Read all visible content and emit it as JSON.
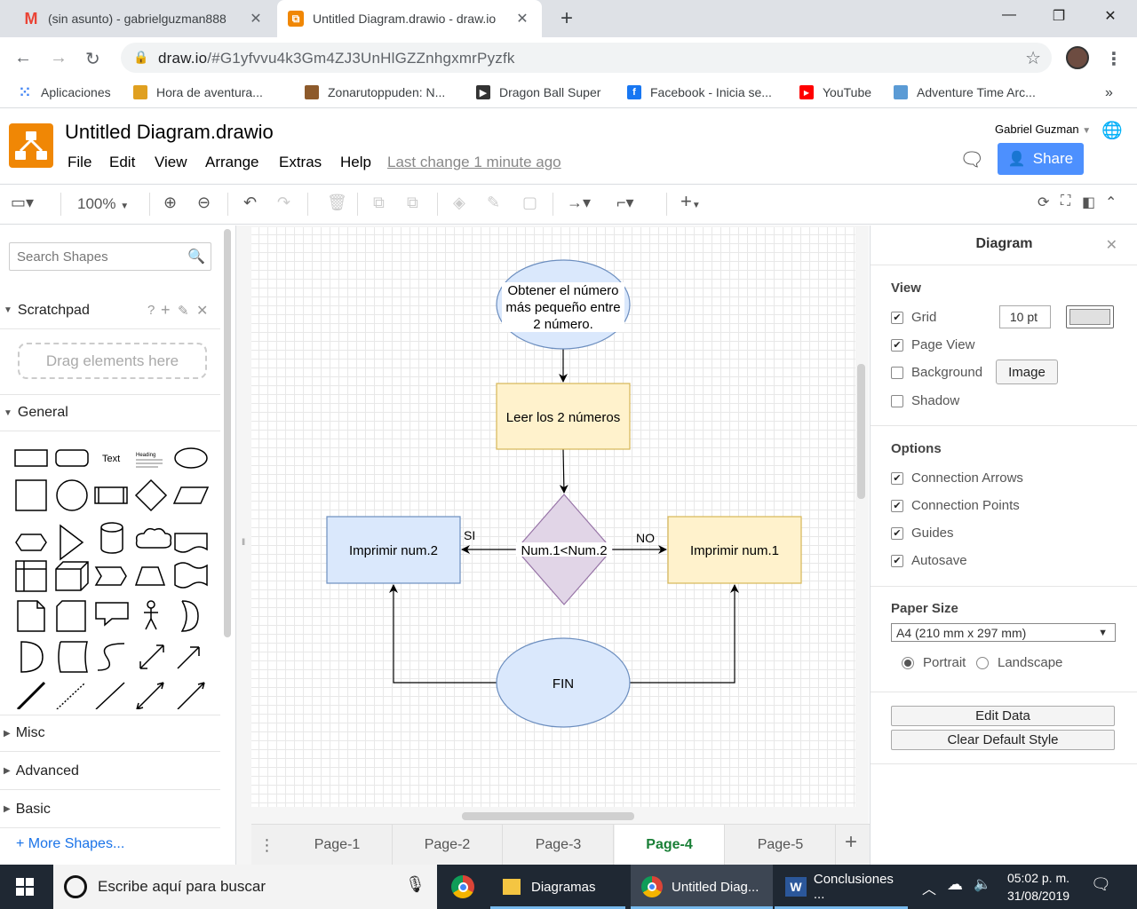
{
  "browser": {
    "tabs": [
      {
        "title": "(sin asunto) - gabrielguzman888",
        "icon": "gmail-icon"
      },
      {
        "title": "Untitled Diagram.drawio - draw.io",
        "icon": "drawio-icon"
      }
    ],
    "url_host": "draw.io",
    "url_path": "/#G1yfvvu4k3Gm4ZJ3UnHlGZZnhgxmrPyzfk",
    "bookmarks": [
      {
        "label": "Aplicaciones",
        "color": "#4285f4"
      },
      {
        "label": "Hora de aventura...",
        "color": "#e0a020"
      },
      {
        "label": "Zonarutoppuden: N...",
        "color": "#8d5a2b"
      },
      {
        "label": "Dragon Ball Super",
        "color": "#333333"
      },
      {
        "label": "Facebook - Inicia se...",
        "color": "#1877f2"
      },
      {
        "label": "YouTube",
        "color": "#ff0000"
      },
      {
        "label": "Adventure Time Arc...",
        "color": "#5b9bd5"
      }
    ]
  },
  "app": {
    "title": "Untitled Diagram.drawio",
    "menus": [
      "File",
      "Edit",
      "View",
      "Arrange",
      "Extras",
      "Help"
    ],
    "last_change": "Last change 1 minute ago",
    "user": "Gabriel Guzman",
    "share_label": "Share",
    "zoom": "100%"
  },
  "left": {
    "search_placeholder": "Search Shapes",
    "scratchpad": "Scratchpad",
    "scratchpad_tools": "?",
    "drag_hint": "Drag elements here",
    "general": "General",
    "shape_text": "Text",
    "shape_heading": "Heading",
    "misc": "Misc",
    "advanced": "Advanced",
    "basic": "Basic",
    "more_shapes": "+ More Shapes..."
  },
  "diagram": {
    "start_lines": [
      "Obtener el número",
      "más pequeño entre",
      "2 número."
    ],
    "read": "Leer los 2 números",
    "decision": "Num.1<Num.2",
    "yes": "SI",
    "no": "NO",
    "out_left": "Imprimir num.2",
    "out_right": "Imprimir num.1",
    "end": "FIN",
    "colors": {
      "blue_fill": "#dae8fc",
      "blue_stroke": "#6c8ebf",
      "yellow_fill": "#fff2cc",
      "yellow_stroke": "#d6b656",
      "purple_fill": "#e1d5e7",
      "purple_stroke": "#9673a6"
    }
  },
  "right": {
    "title": "Diagram",
    "view": "View",
    "grid": "Grid",
    "grid_size": "10 pt",
    "page_view": "Page View",
    "background": "Background",
    "image_btn": "Image",
    "shadow": "Shadow",
    "options": "Options",
    "connection_arrows": "Connection Arrows",
    "connection_points": "Connection Points",
    "guides": "Guides",
    "autosave": "Autosave",
    "paper_size": "Paper Size",
    "paper_value": "A4 (210 mm x 297 mm)",
    "portrait": "Portrait",
    "landscape": "Landscape",
    "edit_data": "Edit Data",
    "clear_style": "Clear Default Style"
  },
  "pages": [
    "Page-1",
    "Page-2",
    "Page-3",
    "Page-4",
    "Page-5"
  ],
  "active_page": "Page-4",
  "taskbar": {
    "search": "Escribe aquí para buscar",
    "apps": [
      {
        "label": "Diagramas"
      },
      {
        "label": "Untitled Diag..."
      },
      {
        "label": "Conclusiones ..."
      }
    ],
    "time": "05:02 p. m.",
    "date": "31/08/2019"
  }
}
